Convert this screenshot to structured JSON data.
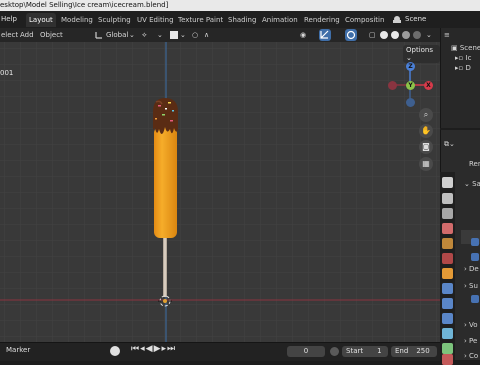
{
  "titlebar": {
    "path": "esktop\\Model Selling\\Ice cream\\icecream.blend]"
  },
  "topmenu": {
    "help": "Help"
  },
  "workspace_tabs": [
    "Layout",
    "Modeling",
    "Sculpting",
    "UV Editing",
    "Texture Paint",
    "Shading",
    "Animation",
    "Rendering",
    "Compositin"
  ],
  "scene": {
    "label": "Scene"
  },
  "header": {
    "select": "elect",
    "add": "Add",
    "object": "Object",
    "orientation": "Global",
    "options": "Options"
  },
  "viewport": {
    "frame_label": "001"
  },
  "outliner": {
    "items": [
      "Scene",
      "Ic",
      "D"
    ]
  },
  "properties": {
    "render_label": "Ren",
    "sa_label": "Sa",
    "rows": [
      "De",
      "Su",
      "Vo",
      "Pe",
      "Co"
    ]
  },
  "timeline": {
    "marker": "Marker",
    "current_frame": "0",
    "start_label": "Start",
    "start_value": "1",
    "end_label": "End",
    "end_value": "250"
  },
  "gizmo": {
    "z": "Z",
    "y": "Y",
    "x": "X"
  },
  "colors": {
    "accent": "#4772b3",
    "x_axis": "#d63a4a",
    "y_axis": "#8bc34a",
    "z_axis": "#4a7fd6",
    "popsicle": "#f5a01f",
    "chocolate": "#5a2c14"
  }
}
